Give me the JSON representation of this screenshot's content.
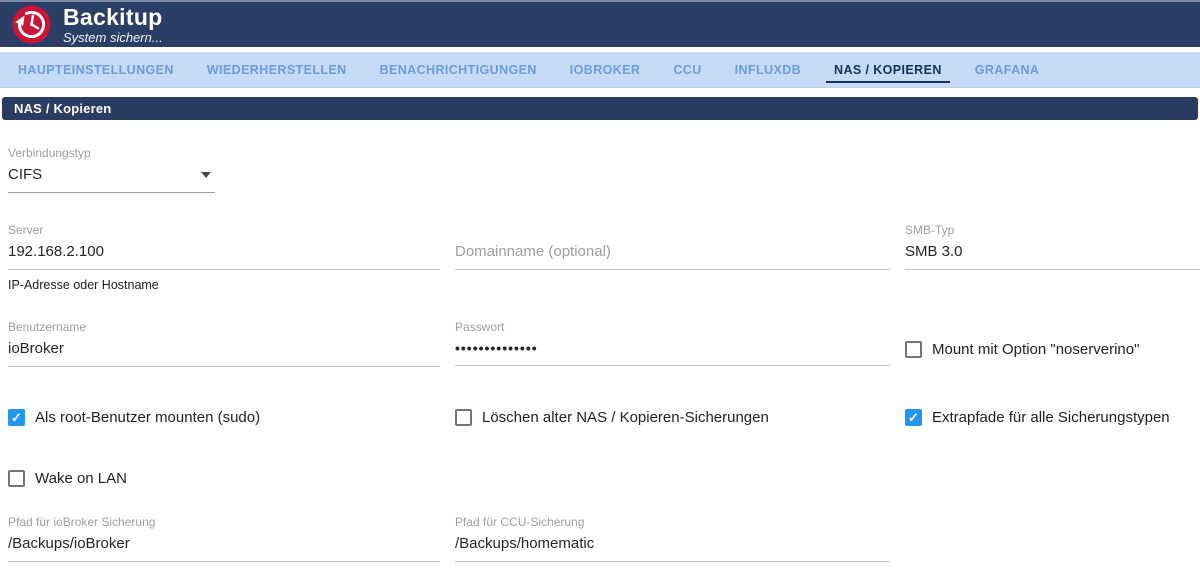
{
  "header": {
    "title": "Backitup",
    "subtitle": "System sichern...",
    "logo_icon": "backup-clock-icon"
  },
  "tabs": [
    {
      "label": "HAUPTEINSTELLUNGEN",
      "active": false
    },
    {
      "label": "WIEDERHERSTELLEN",
      "active": false
    },
    {
      "label": "BENACHRICHTIGUNGEN",
      "active": false
    },
    {
      "label": "IOBROKER",
      "active": false
    },
    {
      "label": "CCU",
      "active": false
    },
    {
      "label": "INFLUXDB",
      "active": false
    },
    {
      "label": "NAS / KOPIEREN",
      "active": true
    },
    {
      "label": "GRAFANA",
      "active": false
    }
  ],
  "section": {
    "title": "NAS / Kopieren"
  },
  "form": {
    "verbindungstyp": {
      "label": "Verbindungstyp",
      "value": "CIFS"
    },
    "server": {
      "label": "Server",
      "value": "192.168.2.100",
      "helper": "IP-Adresse oder Hostname"
    },
    "domain": {
      "placeholder": "Domainname (optional)",
      "value": ""
    },
    "smb": {
      "label": "SMB-Typ",
      "value": "SMB 3.0"
    },
    "benutzername": {
      "label": "Benutzername",
      "value": "ioBroker"
    },
    "passwort": {
      "label": "Passwort",
      "value": "••••••••••••••"
    },
    "checkboxes": {
      "noserverino": {
        "label": "Mount mit Option \"noserverino\"",
        "checked": false
      },
      "sudo": {
        "label": "Als root-Benutzer mounten (sudo)",
        "checked": true
      },
      "delete_old": {
        "label": "Löschen alter NAS / Kopieren-Sicherungen",
        "checked": false
      },
      "extra_paths": {
        "label": "Extrapfade für alle Sicherungstypen",
        "checked": true
      },
      "wol": {
        "label": "Wake on LAN",
        "checked": false
      }
    },
    "pfad_iobroker": {
      "label": "Pfad für ioBroker Sicherung",
      "value": "/Backups/ioBroker"
    },
    "pfad_ccu": {
      "label": "Pfad für CCU-Sicherung",
      "value": "/Backups/homematic"
    }
  },
  "colors": {
    "header_bg": "#2b3f66",
    "section_bg": "#2a3c62",
    "tab_bar_bg": "#c5dbf8",
    "tab_inactive": "#6d9ae0",
    "tab_active": "#16305e",
    "checkbox_accent": "#2196f3",
    "logo_red": "#c91535"
  }
}
